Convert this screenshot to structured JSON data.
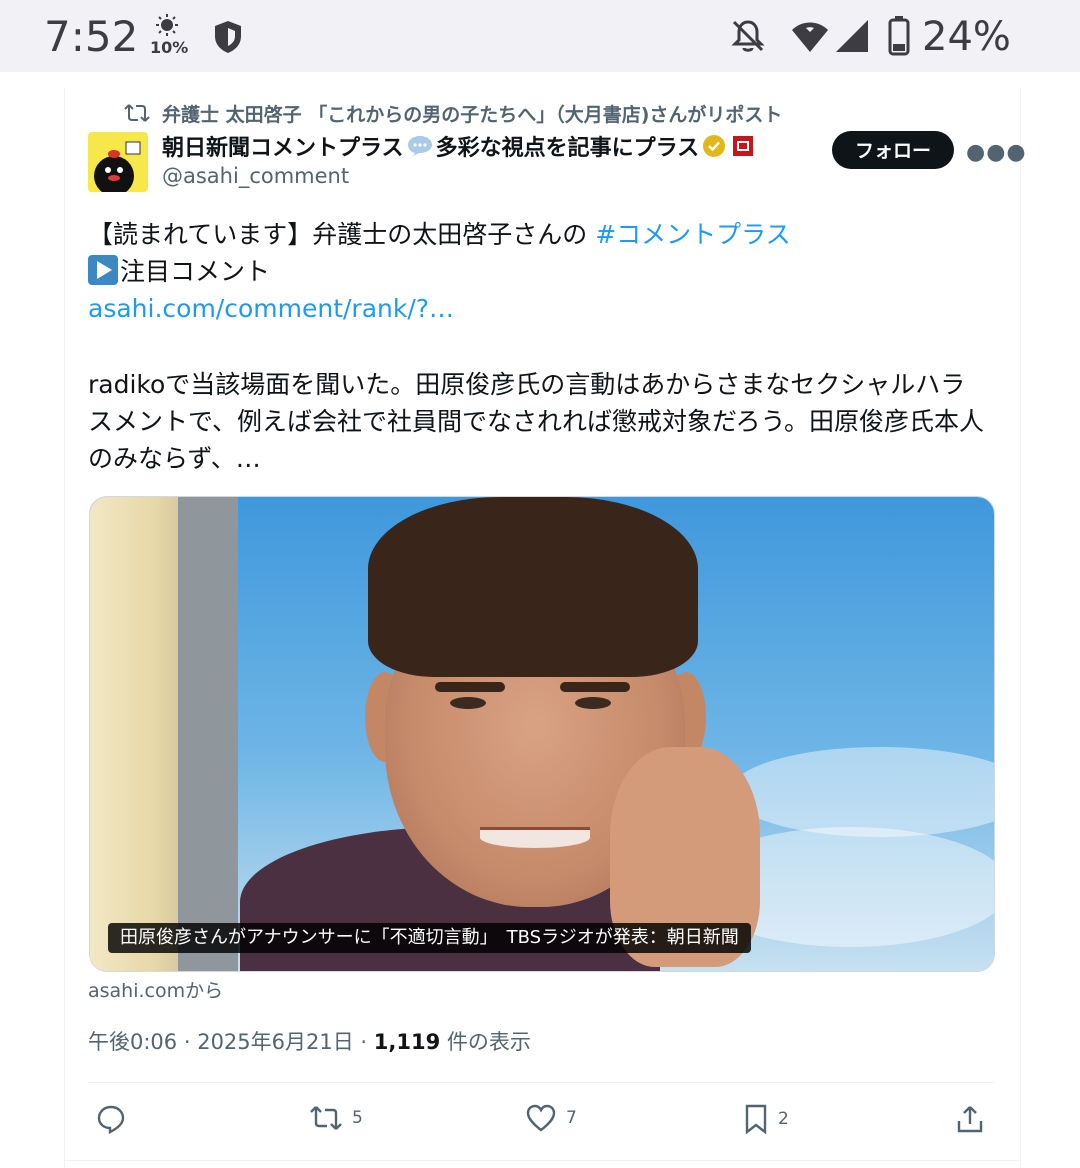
{
  "status_bar": {
    "time": "7:52",
    "brightness": "10%",
    "battery": "24%",
    "icons": [
      "brightness-icon",
      "shield-icon",
      "notifications-off-icon",
      "wifi-icon",
      "signal-icon",
      "battery-icon"
    ]
  },
  "repost": {
    "text": "弁護士 太田啓子 「これからの男の子たちへ」（大月書店)さんがリポスト"
  },
  "author": {
    "name_part1": "朝日新聞コメントプラス",
    "name_part2": "多彩な視点を記事にプラス",
    "handle": "@asahi_comment",
    "follow_label": "フォロー"
  },
  "tweet": {
    "line1_text": "【読まれています】弁護士の太田啓子さんの ",
    "hashtag": "#コメントプラス",
    "line2_text": "注目コメント",
    "link": "asahi.com/comment/rank/?…",
    "paragraph": "radikoで当該場面を聞いた。田原俊彦氏の言動はあからさまなセクシャルハラスメントで、例えば会社で社員間でなされれば懲戒対象だろう。田原俊彦氏本人のみならず、…"
  },
  "media": {
    "caption": "田原俊彦さんがアナウンサーに「不適切言動」　TBSラジオが発表：朝日新聞",
    "source": "asahi.comから"
  },
  "meta": {
    "time": "午後0:06",
    "sep1": " · ",
    "date": "2025年6月21日",
    "sep2": " · ",
    "views_count": "1,119",
    "views_label": " 件の表示"
  },
  "actions": {
    "reply_count": "",
    "retweet_count": "5",
    "like_count": "7",
    "bookmark_count": "2"
  },
  "colors": {
    "accent": "#1d9bf0",
    "text": "#0f1419",
    "secondary": "#536471",
    "verified": "#e2b719"
  }
}
